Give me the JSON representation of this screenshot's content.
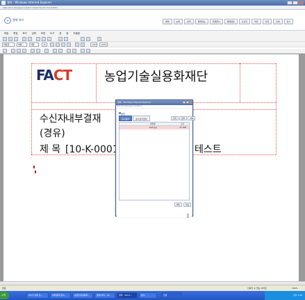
{
  "window": {
    "title": "결재 - Windows Internet Explorer",
    "address": "http://fact.site/approval/document?docId=10-K-0001"
  },
  "page_header": {
    "logo_text": "e",
    "title": "결재 처리",
    "toolbar_buttons": [
      "결재",
      "보류",
      "반려",
      "결재정보",
      "진행문서",
      "결재경로",
      "수신자",
      "의견",
      "이력",
      "인쇄",
      "닫기"
    ]
  },
  "editor": {
    "menu": [
      "파일",
      "편집",
      "보기",
      "입력",
      "모양",
      "도구",
      "표",
      "창",
      "도움말"
    ],
    "font_combo": "바탕",
    "size_combo": "10",
    "zoom_combo": "100%",
    "style_combo": "바탕글"
  },
  "document": {
    "logo_f": "FA",
    "logo_ct": "CT",
    "org_name": "농업기술실용화재단",
    "receiver_label": "수신자",
    "receiver_value": "내부결재",
    "via_label": "(경유)",
    "subject_label": "제  목",
    "subject_value": "[10-K-0001] 농업기술실용화재단 결재테스트",
    "subject_tail": "테스트"
  },
  "modal": {
    "title": "첨부 - Windows Internet Explorer",
    "address": "http://fact.site/approval/attach",
    "heading": "첨부",
    "tabs": [
      "문서첨부",
      "문서관리첨부"
    ],
    "action_buttons": [
      "열기",
      "첨부",
      "삭제"
    ],
    "columns": {
      "name": "파일명",
      "size": "크기"
    },
    "rows": [
      {
        "name": "text.jpg",
        "size": "75.7KB"
      }
    ],
    "bottom_buttons": [
      "확인",
      "취소"
    ]
  },
  "status": {
    "left": "완료",
    "zone": "신뢰할 수 있는 사이트",
    "zoom": "100%"
  },
  "taskbar": {
    "start": "시작",
    "tasks": [
      "FACT 내부 포...",
      "내부결재 문서...",
      "농업기술실용화...",
      "결재 처리 - W...",
      "첨부 - Wind...",
      "문서"
    ],
    "active_index": 4,
    "lang": "한글",
    "time": "오후 2:44"
  }
}
